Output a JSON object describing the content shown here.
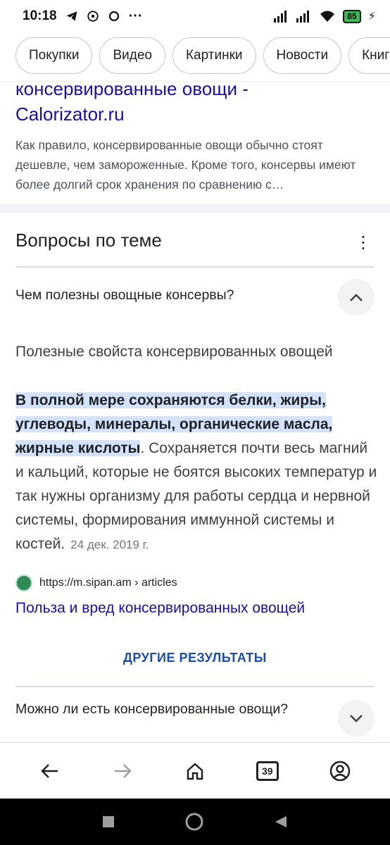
{
  "status": {
    "time": "10:18",
    "battery": "85"
  },
  "chips": [
    "Покупки",
    "Видео",
    "Картинки",
    "Новости",
    "Книги"
  ],
  "result": {
    "title_line1": "консервированные овощи -",
    "title_line2": "Calorizator.ru",
    "snippet": "Как правило, консервированные овощи обычно стоят дешевле, чем замороженные. Кроме того, консервы имеют более долгий срок хранения по сравнению с…"
  },
  "paa": {
    "heading": "Вопросы по теме",
    "q1": "Чем полезны овощные консервы?",
    "answer_heading": "Полезные свойста консервированных овощей",
    "answer_highlight": "В полной мере сохраняются белки, жиры, углеводы, минералы, органические масла, жирные кислоты",
    "answer_rest": ". Сохраняется почти весь магний и кальций, которые не боятся высоких температур и так нужны организму для работы сердца и нервной системы, формирования иммунной системы и костей.",
    "answer_date": "24 дек. 2019 г.",
    "source_url": "https://m.sipan.am › articles",
    "source_title": "Польза и вред консервированных овощей",
    "more_label": "ДРУГИЕ РЕЗУЛЬТАТЫ",
    "q2": "Можно ли есть консервированные овощи?"
  },
  "bottom_nav": {
    "tabs_count": "39"
  }
}
